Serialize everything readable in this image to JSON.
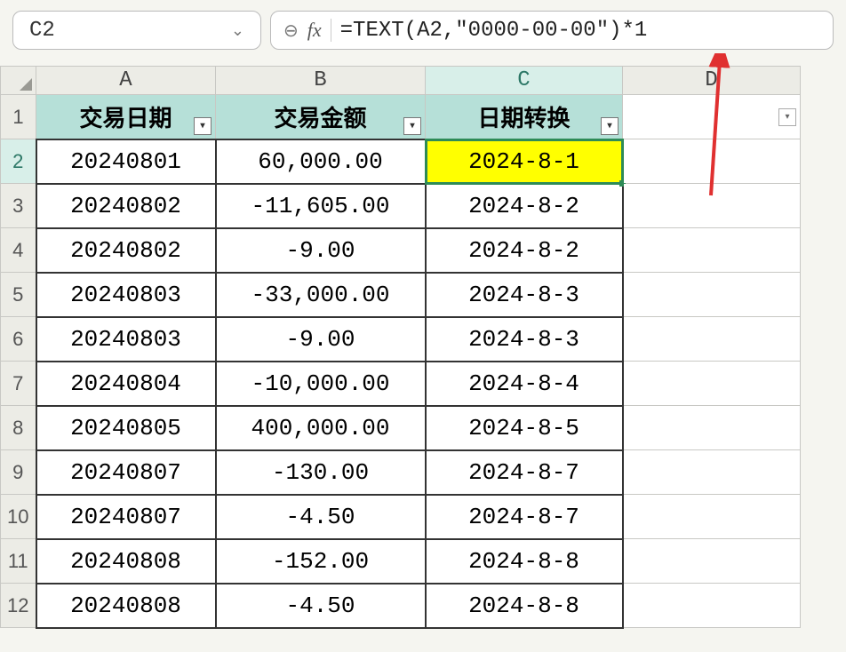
{
  "nameBox": {
    "ref": "C2"
  },
  "formulaBar": {
    "fx_label": "fx",
    "formula": "=TEXT(A2,\"0000-00-00\")*1"
  },
  "columns": {
    "A": "A",
    "B": "B",
    "C": "C",
    "D": "D"
  },
  "rowNumbers": [
    "1",
    "2",
    "3",
    "4",
    "5",
    "6",
    "7",
    "8",
    "9",
    "10",
    "11",
    "12"
  ],
  "headers": {
    "A": "交易日期",
    "B": "交易金额",
    "C": "日期转换"
  },
  "rows": [
    {
      "A": "20240801",
      "B": "60,000.00",
      "C": "2024-8-1"
    },
    {
      "A": "20240802",
      "B": "-11,605.00",
      "C": "2024-8-2"
    },
    {
      "A": "20240802",
      "B": "-9.00",
      "C": "2024-8-2"
    },
    {
      "A": "20240803",
      "B": "-33,000.00",
      "C": "2024-8-3"
    },
    {
      "A": "20240803",
      "B": "-9.00",
      "C": "2024-8-3"
    },
    {
      "A": "20240804",
      "B": "-10,000.00",
      "C": "2024-8-4"
    },
    {
      "A": "20240805",
      "B": "400,000.00",
      "C": "2024-8-5"
    },
    {
      "A": "20240807",
      "B": "-130.00",
      "C": "2024-8-7"
    },
    {
      "A": "20240807",
      "B": "-4.50",
      "C": "2024-8-7"
    },
    {
      "A": "20240808",
      "B": "-152.00",
      "C": "2024-8-8"
    },
    {
      "A": "20240808",
      "B": "-4.50",
      "C": "2024-8-8"
    }
  ],
  "activeCell": {
    "col": "C",
    "row": 2
  }
}
